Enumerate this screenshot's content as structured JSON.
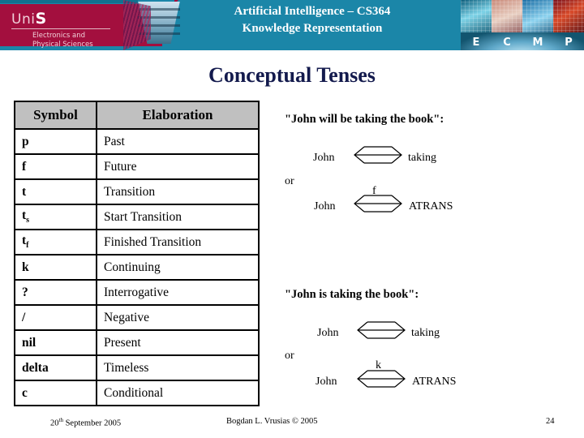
{
  "banner": {
    "course_title_line1": "Artificial Intelligence – CS364",
    "course_title_line2": "Knowledge Representation",
    "logo_word_pre": "Uni",
    "logo_word_bold": "S",
    "logo_sub_line1": "Electronics and",
    "logo_sub_line2": "Physical Sciences",
    "photo_letters": [
      "E",
      "C",
      "M",
      "P"
    ],
    "colors": {
      "teal": "#1b86a8",
      "maroon": "#a30f3e",
      "logo_text": "#f0cfd8"
    }
  },
  "slide": {
    "title": "Conceptual Tenses",
    "title_color": "#131a4d"
  },
  "table": {
    "headers": [
      "Symbol",
      "Elaboration"
    ],
    "header_bg": "#c0c0c0",
    "rows": [
      {
        "symbol": "p",
        "sub": "",
        "elaboration": "Past"
      },
      {
        "symbol": "f",
        "sub": "",
        "elaboration": "Future"
      },
      {
        "symbol": "t",
        "sub": "",
        "elaboration": "Transition"
      },
      {
        "symbol": "t",
        "sub": "s",
        "elaboration": "Start Transition"
      },
      {
        "symbol": "t",
        "sub": "f",
        "elaboration": "Finished Transition"
      },
      {
        "symbol": "k",
        "sub": "",
        "elaboration": "Continuing"
      },
      {
        "symbol": "?",
        "sub": "",
        "elaboration": "Interrogative"
      },
      {
        "symbol": "/",
        "sub": "",
        "elaboration": "Negative"
      },
      {
        "symbol": "nil",
        "sub": "",
        "elaboration": "Present"
      },
      {
        "symbol": "delta",
        "sub": "",
        "elaboration": "Timeless"
      },
      {
        "symbol": "c",
        "sub": "",
        "elaboration": "Conditional"
      }
    ]
  },
  "examples": [
    {
      "caption": "\"John will be taking the book\":",
      "or_label": "or",
      "diagram1": {
        "left": "John",
        "right": "taking",
        "tag": ""
      },
      "diagram2": {
        "left": "John",
        "right": "ATRANS",
        "tag": "f"
      }
    },
    {
      "caption": "\"John is taking the book\":",
      "or_label": "or",
      "diagram1": {
        "left": "John",
        "right": "taking",
        "tag": ""
      },
      "diagram2": {
        "left": "John",
        "right": "ATRANS",
        "tag": "k"
      }
    }
  ],
  "footer": {
    "date_number": "20",
    "date_ordinal": "th",
    "date_rest": " September 2005",
    "author": "Bogdan L. Vrusias © 2005",
    "page": "24"
  }
}
